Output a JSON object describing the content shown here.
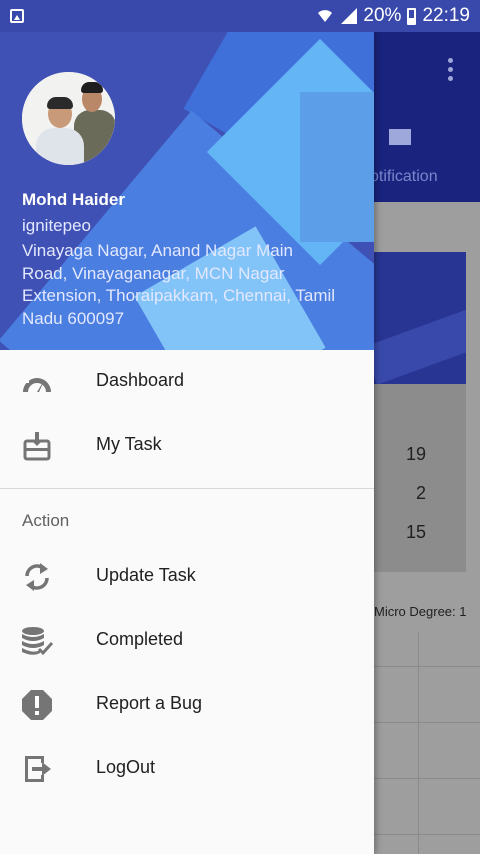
{
  "status_bar": {
    "battery": "20%",
    "time": "22:19"
  },
  "background": {
    "tab_label": "otification",
    "numbers": [
      "19",
      "2",
      "15"
    ],
    "micro_degree": "Micro Degree: 1"
  },
  "drawer": {
    "user": {
      "name": "Mohd Haider",
      "company": "ignitepeo",
      "address": "Vinayaga Nagar, Anand Nagar Main Road, Vinayaganagar, MCN Nagar Extension, Thoraipakkam, Chennai, Tamil Nadu 600097"
    },
    "menu": [
      {
        "label": "Dashboard",
        "icon": "speedometer-icon"
      },
      {
        "label": "My Task",
        "icon": "inbox-download-icon"
      }
    ],
    "section_title": "Action",
    "actions": [
      {
        "label": "Update Task",
        "icon": "sync-icon"
      },
      {
        "label": "Completed",
        "icon": "database-check-icon"
      },
      {
        "label": "Report a Bug",
        "icon": "alert-octagon-icon"
      },
      {
        "label": "LogOut",
        "icon": "logout-icon"
      }
    ]
  }
}
